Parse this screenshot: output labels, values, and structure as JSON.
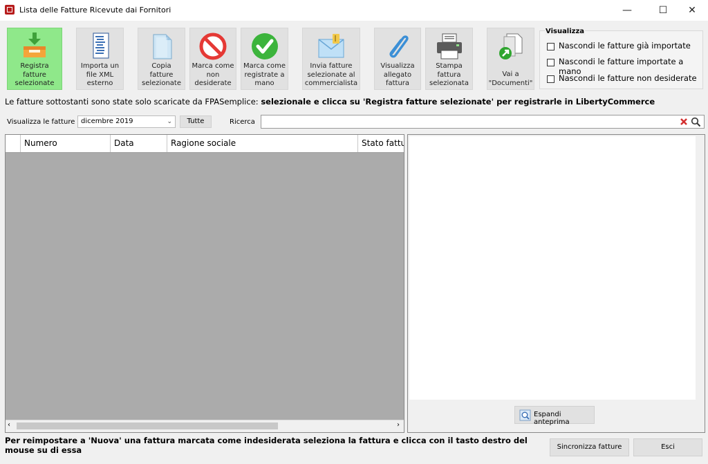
{
  "window": {
    "title": "Lista delle Fatture Ricevute dai Fornitori",
    "minimize": "—",
    "maximize": "☐",
    "close": "✕"
  },
  "toolbar": [
    {
      "id": "registra",
      "label_lines": [
        "Registra",
        "fatture",
        "selezionate"
      ]
    },
    {
      "id": "importa",
      "label_lines": [
        "Importa un",
        "file XML",
        "esterno"
      ]
    },
    {
      "id": "copia",
      "label_lines": [
        "Copia",
        "fatture",
        "selezionate"
      ]
    },
    {
      "id": "marca-non-desiderate",
      "label_lines": [
        "Marca come",
        "non",
        "desiderate"
      ]
    },
    {
      "id": "marca-registrate",
      "label_lines": [
        "Marca come",
        "registrate a",
        "mano"
      ]
    },
    {
      "id": "invia",
      "label_lines": [
        "Invia fatture",
        "selezionate al",
        "commercialista"
      ]
    },
    {
      "id": "visualizza-allegato",
      "label_lines": [
        "Visualizza",
        "allegato",
        "fattura"
      ]
    },
    {
      "id": "stampa",
      "label_lines": [
        "Stampa",
        "fattura",
        "selezionata"
      ]
    },
    {
      "id": "documenti",
      "label_lines": [
        "Vai a",
        "\"Documenti\""
      ]
    }
  ],
  "visualizza": {
    "title": "Visualizza",
    "options": [
      {
        "label": "Nascondi le fatture già importate",
        "checked": false
      },
      {
        "label": "Nascondi le fatture importate a mano",
        "checked": false
      },
      {
        "label": "Nascondi le fatture non desiderate",
        "checked": false
      }
    ]
  },
  "info": {
    "normal": "Le fatture sottostanti sono state solo scaricate da FPASemplice: ",
    "bold": "selezionale e clicca su 'Registra fatture selezionate' per registrarle in LibertyCommerce"
  },
  "filter": {
    "label": "Visualizza le fatture di",
    "month_value": "dicembre 2019",
    "all_button": "Tutte",
    "search_label": "Ricerca",
    "search_value": ""
  },
  "grid": {
    "columns": [
      "Numero",
      "Data",
      "Ragione sociale",
      "Stato fattura"
    ],
    "rows": []
  },
  "preview": {
    "expand_button": "Espandi anteprima"
  },
  "footer": {
    "hint": "Per reimpostare a 'Nuova' una fattura marcata come indesiderata seleziona la fattura e clicca con il tasto destro del mouse su di essa",
    "sync_button": "Sincronizza fatture",
    "exit_button": "Esci"
  },
  "colors": {
    "primary_button": "#8fe88a",
    "grid_background": "#ababab",
    "reject": "#e53935",
    "ok": "#3cb43c"
  }
}
